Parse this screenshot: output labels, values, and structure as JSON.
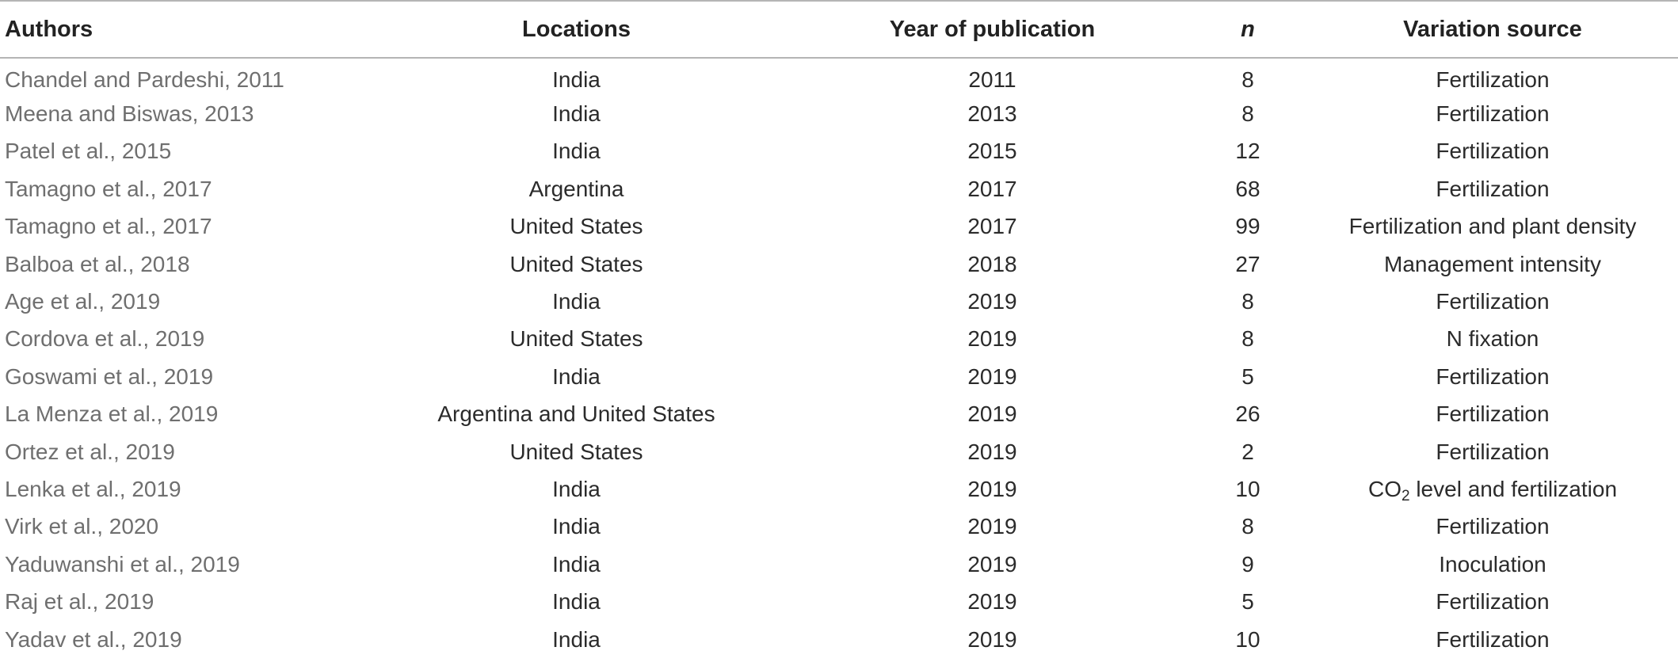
{
  "table": {
    "headers": {
      "authors": "Authors",
      "locations": "Locations",
      "year": "Year of publication",
      "n": "n",
      "variation": "Variation source"
    },
    "rows": [
      {
        "author": "Chandel and Pardeshi, 2011",
        "location": "India",
        "year": "2011",
        "n": "8",
        "variation": "Fertilization"
      },
      {
        "author": "Meena and Biswas, 2013",
        "location": "India",
        "year": "2013",
        "n": "8",
        "variation": "Fertilization"
      },
      {
        "author": "Patel et al., 2015",
        "location": "India",
        "year": "2015",
        "n": "12",
        "variation": "Fertilization"
      },
      {
        "author": "Tamagno et al., 2017",
        "location": "Argentina",
        "year": "2017",
        "n": "68",
        "variation": "Fertilization"
      },
      {
        "author": "Tamagno et al., 2017",
        "location": "United States",
        "year": "2017",
        "n": "99",
        "variation": "Fertilization and plant density"
      },
      {
        "author": "Balboa et al., 2018",
        "location": "United States",
        "year": "2018",
        "n": "27",
        "variation": "Management intensity"
      },
      {
        "author": "Age et al., 2019",
        "location": "India",
        "year": "2019",
        "n": "8",
        "variation": "Fertilization"
      },
      {
        "author": "Cordova et al., 2019",
        "location": "United States",
        "year": "2019",
        "n": "8",
        "variation": "N fixation"
      },
      {
        "author": "Goswami et al., 2019",
        "location": "India",
        "year": "2019",
        "n": "5",
        "variation": "Fertilization"
      },
      {
        "author": "La Menza et al., 2019",
        "location": "Argentina and United States",
        "year": "2019",
        "n": "26",
        "variation": "Fertilization"
      },
      {
        "author": "Ortez et al., 2019",
        "location": "United States",
        "year": "2019",
        "n": "2",
        "variation": "Fertilization"
      },
      {
        "author": "Lenka et al., 2019",
        "location": "India",
        "year": "2019",
        "n": "10",
        "variation_prefix": "CO",
        "variation_sub": "2",
        "variation_suffix": " level and fertilization"
      },
      {
        "author": "Virk et al., 2020",
        "location": "India",
        "year": "2019",
        "n": "8",
        "variation": "Fertilization"
      },
      {
        "author": "Yaduwanshi et al., 2019",
        "location": "India",
        "year": "2019",
        "n": "9",
        "variation": "Inoculation"
      },
      {
        "author": "Raj et al., 2019",
        "location": "India",
        "year": "2019",
        "n": "5",
        "variation": "Fertilization"
      },
      {
        "author": "Yadav et al., 2019",
        "location": "India",
        "year": "2019",
        "n": "10",
        "variation": "Fertilization"
      }
    ]
  }
}
